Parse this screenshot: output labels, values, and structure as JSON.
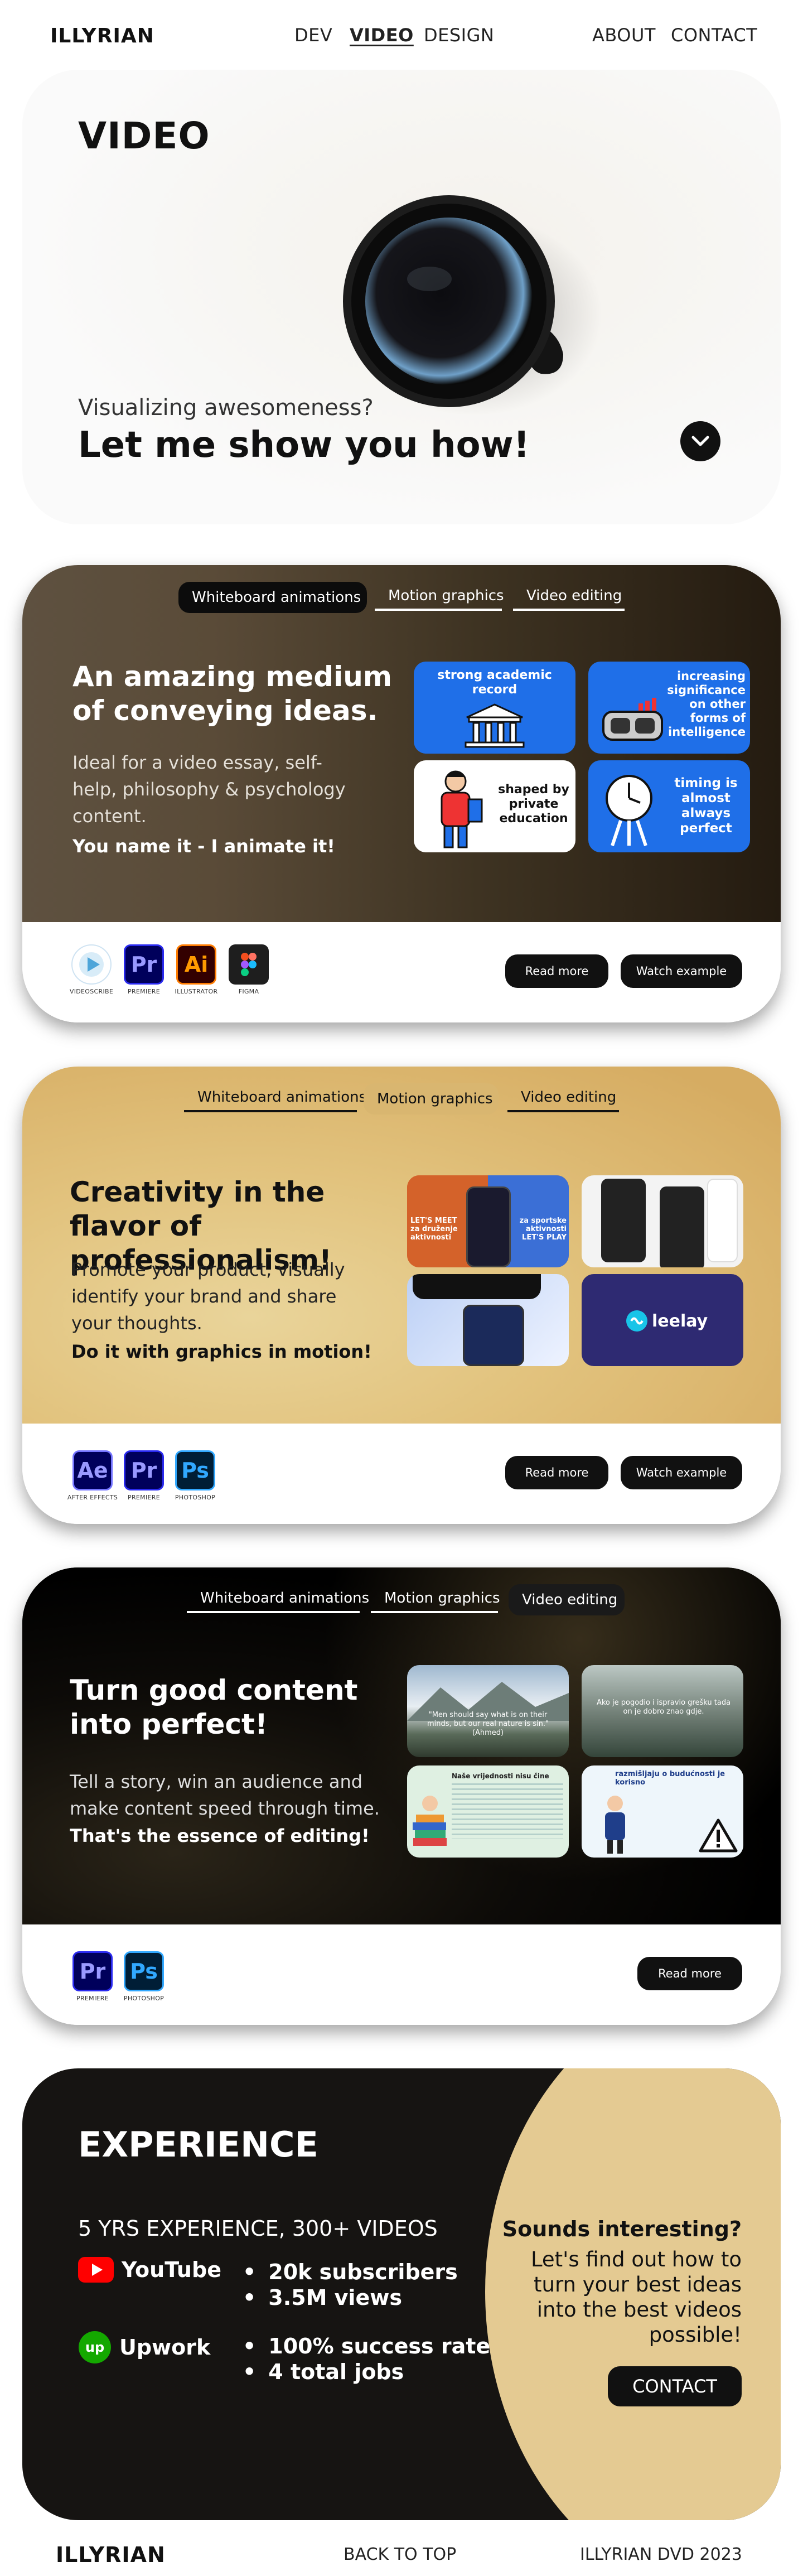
{
  "nav": {
    "logo": "ILLYRIAN",
    "dev": "DEV",
    "video": "VIDEO",
    "design": "DESIGN",
    "about": "ABOUT",
    "contact": "CONTACT"
  },
  "hero": {
    "title": "VIDEO",
    "subtitle": "Visualizing awesomeness?",
    "headline": "Let me show you how!"
  },
  "card1": {
    "tabs": [
      "Whiteboard animations",
      "Motion graphics",
      "Video editing"
    ],
    "heading": "An amazing medium of conveying ideas.",
    "description": "Ideal for a video essay, self-help, philosophy & psychology content.",
    "strong": "You name it - I animate it!",
    "thumbs": [
      "strong academic record",
      "increasing significance on other forms of intelligence",
      "shaped by private education",
      "timing is almost always perfect"
    ],
    "tools": [
      {
        "label": "Vs",
        "caption": "VIDEOSCRIBE"
      },
      {
        "label": "Pr",
        "caption": "PREMIERE"
      },
      {
        "label": "Ai",
        "caption": "ILLUSTRATOR"
      },
      {
        "label": "F",
        "caption": "FIGMA"
      }
    ],
    "read_more": "Read more",
    "watch": "Watch example"
  },
  "card2": {
    "tabs": [
      "Whiteboard animations",
      "Motion graphics",
      "Video editing"
    ],
    "heading": "Creativity in the flavor of professionalism!",
    "description": "Promote your product, visually identify your brand and share your thoughts.",
    "strong": "Do it with graphics in motion!",
    "thumb1_left": "LET'S MEET za druženje aktivnosti",
    "thumb1_right": "za sportske aktivnosti LET'S PLAY",
    "thumb4": "leelay",
    "tools": [
      {
        "label": "Ae",
        "caption": "AFTER EFFECTS"
      },
      {
        "label": "Pr",
        "caption": "PREMIERE"
      },
      {
        "label": "Ps",
        "caption": "PHOTOSHOP"
      }
    ],
    "read_more": "Read more",
    "watch": "Watch example"
  },
  "card3": {
    "tabs": [
      "Whiteboard animations",
      "Motion graphics",
      "Video editing"
    ],
    "heading": "Turn good content into perfect!",
    "description": "Tell a story, win an audience and make content speed through time.",
    "strong": "That's the essence of editing!",
    "thumb1": "\"Men should say what is on their minds, but our real nature is sin.\" (Ahmed)",
    "thumb2": "Ako je pogodio i ispravio grešku tada on je dobro znao gdje.",
    "thumb3_title": "Naše vrijednosti nisu čine",
    "thumb4_title": "razmišljaju o budućnosti je korisno",
    "tools": [
      {
        "label": "Pr",
        "caption": "PREMIERE"
      },
      {
        "label": "Ps",
        "caption": "PHOTOSHOP"
      }
    ],
    "read_more": "Read more"
  },
  "experience": {
    "title": "EXPERIENCE",
    "years": "5 YRS EXPERIENCE, 300+ VIDEOS",
    "youtube": "YouTube",
    "yt_stats": [
      "20k subscribers",
      "3.5M views"
    ],
    "upwork": "Upwork",
    "up_stats": [
      "100% success rate",
      "4 total jobs"
    ],
    "question": "Sounds interesting?",
    "answer": "Let's find out how to turn your best ideas into the best videos possible!",
    "contact": "CONTACT"
  },
  "footer": {
    "logo": "ILLYRIAN",
    "back": "BACK TO TOP",
    "copy": "ILLYRIAN DVD 2023"
  }
}
